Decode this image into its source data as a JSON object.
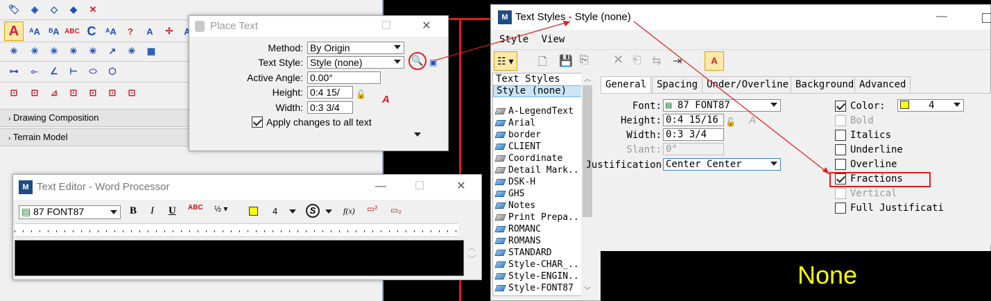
{
  "palette": {
    "sections": [
      "Drawing Composition",
      "Terrain Model"
    ]
  },
  "place_text": {
    "title": "Place Text",
    "method_label": "Method:",
    "method_value": "By Origin",
    "text_style_label": "Text Style:",
    "text_style_value": "Style (none)",
    "active_angle_label": "Active Angle:",
    "active_angle_value": "0.00°",
    "height_label": "Height:",
    "height_value": "0:4 15/",
    "width_label": "Width:",
    "width_value": "0:3 3/4",
    "apply_label": "Apply changes to all text"
  },
  "text_editor": {
    "title": "Text Editor - Word Processor",
    "font_value": "87  FONT87",
    "bold": "B",
    "italic": "I",
    "underline": "U",
    "color_index": "4",
    "fx": "f(x)"
  },
  "text_styles": {
    "title": "Text Styles - Style (none)",
    "menu": [
      "Style",
      "View"
    ],
    "list_header": "Text Styles",
    "selected": "Style (none)",
    "items": [
      {
        "name": "A-LegendText",
        "icon": "grey"
      },
      {
        "name": "Arial",
        "icon": "blue"
      },
      {
        "name": "border",
        "icon": "blue"
      },
      {
        "name": "CLIENT",
        "icon": "blue"
      },
      {
        "name": "Coordinate",
        "icon": "grey"
      },
      {
        "name": "Detail Mark..",
        "icon": "grey"
      },
      {
        "name": "DSK-H",
        "icon": "blue"
      },
      {
        "name": "GHS",
        "icon": "blue"
      },
      {
        "name": "Notes",
        "icon": "blue"
      },
      {
        "name": "Print Prepa..",
        "icon": "grey"
      },
      {
        "name": "ROMANC",
        "icon": "blue"
      },
      {
        "name": "ROMANS",
        "icon": "blue"
      },
      {
        "name": "STANDARD",
        "icon": "blue"
      },
      {
        "name": "Style-CHAR_..",
        "icon": "blue"
      },
      {
        "name": "Style-ENGIN..",
        "icon": "blue"
      },
      {
        "name": "Style-FONT87",
        "icon": "blue"
      }
    ],
    "tabs": [
      "General",
      "Spacing",
      "Under/Overline",
      "Background",
      "Advanced"
    ],
    "font_label": "Font:",
    "font_value": "87  FONT87",
    "height_label": "Height:",
    "height_value": "0:4 15/16",
    "width_label": "Width:",
    "width_value": "0:3 3/4",
    "slant_label": "Slant:",
    "slant_value": "0°",
    "justification_label": "Justification",
    "justification_value": "Center Center",
    "color_label": "Color:",
    "color_value": "4",
    "checks": [
      {
        "label": "Bold",
        "checked": false,
        "disabled": true
      },
      {
        "label": "Italics",
        "checked": false,
        "disabled": false
      },
      {
        "label": "Underline",
        "checked": false,
        "disabled": false
      },
      {
        "label": "Overline",
        "checked": false,
        "disabled": false
      },
      {
        "label": "Fractions",
        "checked": true,
        "disabled": false
      },
      {
        "label": "Vertical",
        "checked": false,
        "disabled": true
      },
      {
        "label": "Full Justificati",
        "checked": false,
        "disabled": false
      }
    ],
    "preview_text": "None"
  },
  "colors": {
    "accent_red": "#e41b1b",
    "swatch_yellow": "#ffff00",
    "preview_yellow": "#ffff00"
  }
}
